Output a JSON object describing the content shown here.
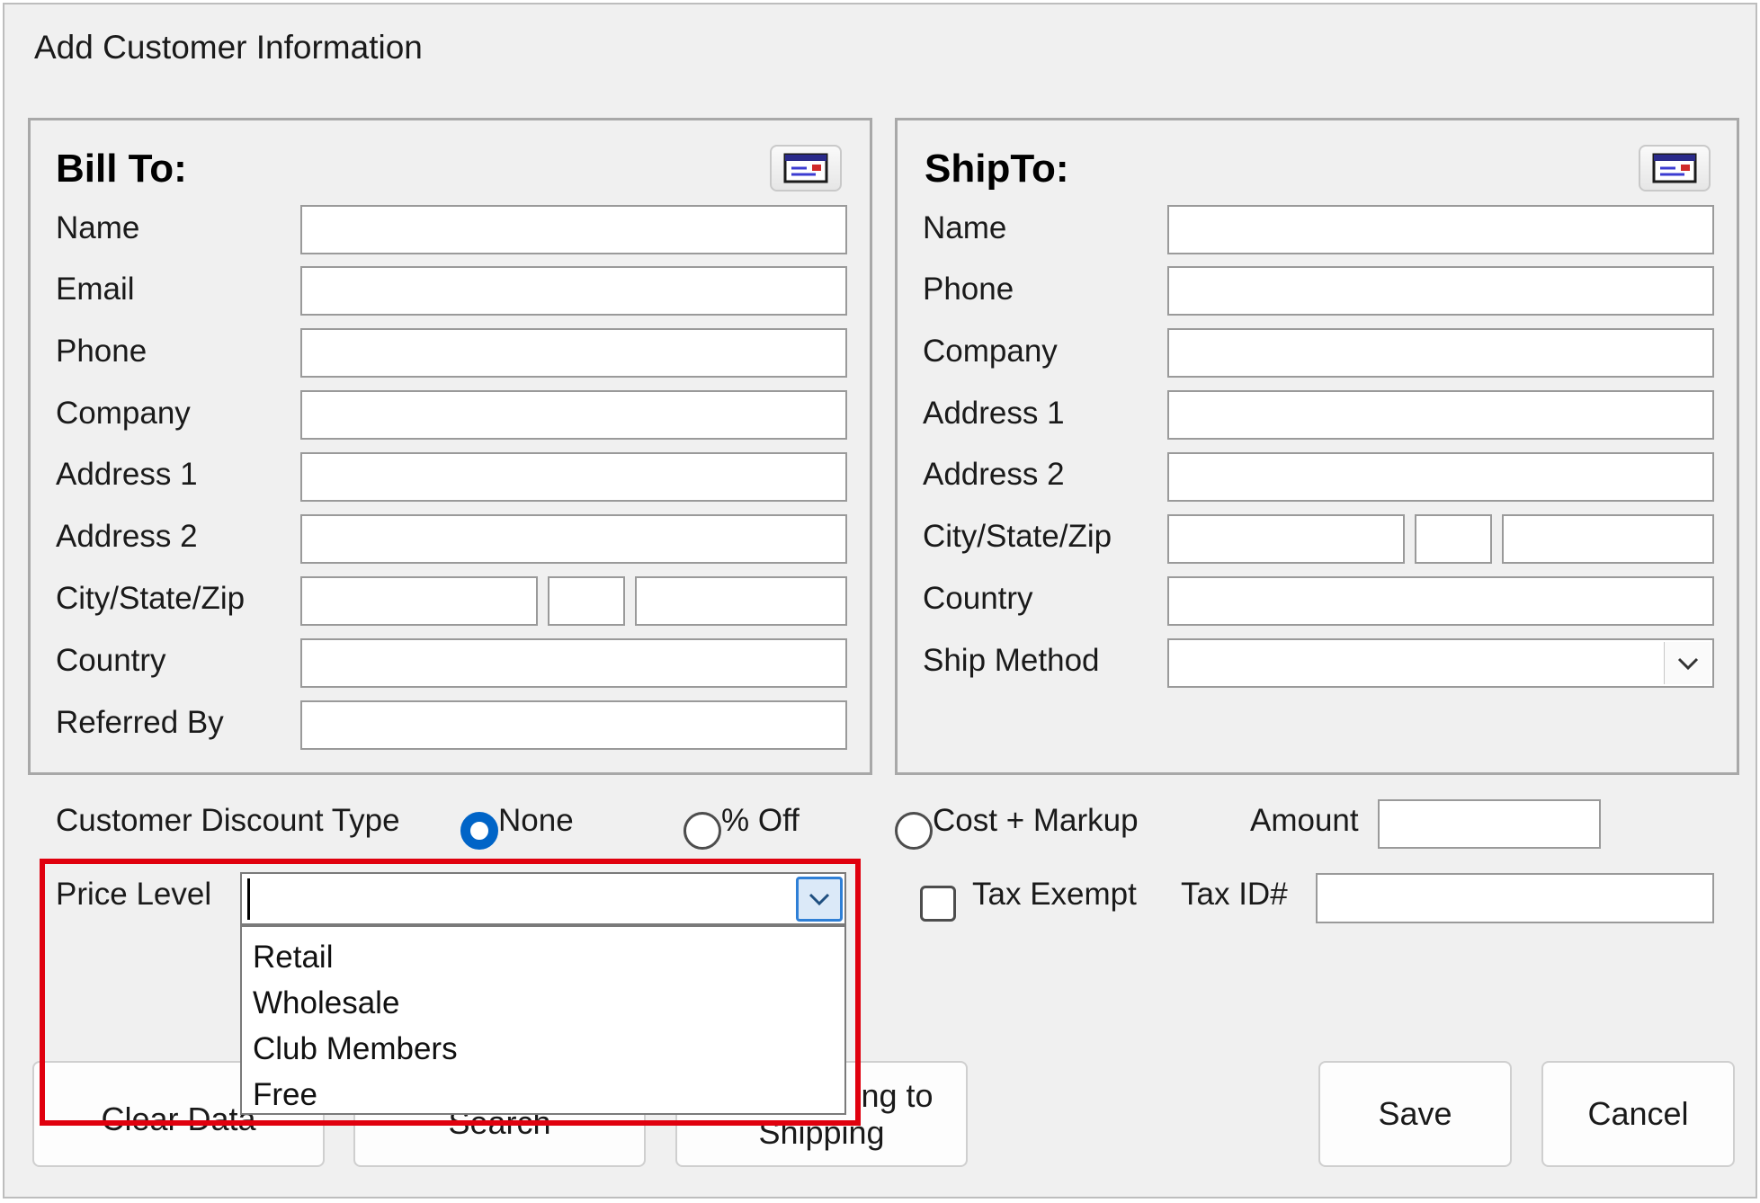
{
  "window": {
    "title": "Add Customer Information"
  },
  "bill_to": {
    "title": "Bill To:",
    "icon": "address-card-icon",
    "labels": {
      "name": "Name",
      "email": "Email",
      "phone": "Phone",
      "company": "Company",
      "address1": "Address 1",
      "address2": "Address 2",
      "city_state_zip": "City/State/Zip",
      "country": "Country",
      "referred_by": "Referred By"
    },
    "values": {
      "name": "",
      "email": "",
      "phone": "",
      "company": "",
      "address1": "",
      "address2": "",
      "city": "",
      "state": "",
      "zip": "",
      "country": "",
      "referred_by": ""
    }
  },
  "ship_to": {
    "title": "ShipTo:",
    "icon": "address-card-icon",
    "labels": {
      "name": "Name",
      "phone": "Phone",
      "company": "Company",
      "address1": "Address 1",
      "address2": "Address 2",
      "city_state_zip": "City/State/Zip",
      "country": "Country",
      "ship_method": "Ship Method"
    },
    "values": {
      "name": "",
      "phone": "",
      "company": "",
      "address1": "",
      "address2": "",
      "city": "",
      "state": "",
      "zip": "",
      "country": "",
      "ship_method": ""
    }
  },
  "discount": {
    "label": "Customer Discount Type",
    "options": [
      "None",
      "% Off",
      "Cost + Markup"
    ],
    "selected": "None",
    "amount_label": "Amount",
    "amount_value": ""
  },
  "price_level": {
    "label": "Price Level",
    "value": "",
    "options": [
      "Retail",
      "Wholesale",
      "Club Members",
      "Free"
    ]
  },
  "tax": {
    "exempt_label": "Tax Exempt",
    "exempt_checked": false,
    "id_label": "Tax ID#",
    "id_value": ""
  },
  "buttons": {
    "clear": "Clear Data",
    "search_partial": "Search",
    "copy_billing_partial_1": "ing to",
    "copy_billing_partial_2": "Shipping",
    "save": "Save",
    "cancel": "Cancel"
  },
  "colors": {
    "window_bg": "#f0f0f0",
    "accent": "#0064c7",
    "highlight_border": "#e0000e"
  }
}
